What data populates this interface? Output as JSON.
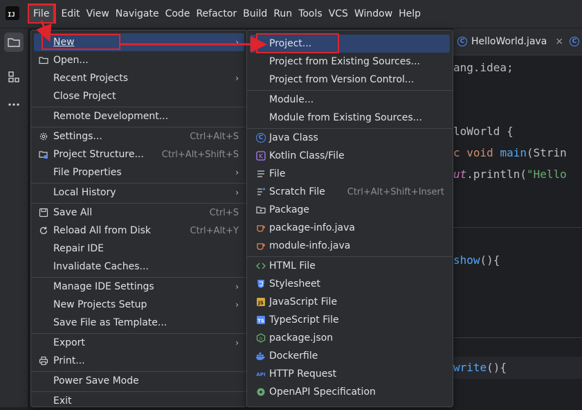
{
  "app": {
    "logo_text": "IJ"
  },
  "menubar": [
    "File",
    "Edit",
    "View",
    "Navigate",
    "Code",
    "Refactor",
    "Build",
    "Run",
    "Tools",
    "VCS",
    "Window",
    "Help"
  ],
  "tabs": [
    {
      "label": "HelloWorld.java",
      "close": "×"
    }
  ],
  "code": {
    "line1": "ang.idea;",
    "line2": "loWorld {",
    "line3a": "c void ",
    "line3b": "main",
    "line3c": "(Strin",
    "line4a": "ut",
    "line4b": ".println(",
    "line4c": "\"Hello",
    "line5a": "show",
    "line5b": "(){",
    "line6a": "write",
    "line6b": "(){"
  },
  "file_menu": {
    "items": [
      {
        "label": "New",
        "arrow": "›"
      },
      {
        "label": "Open..."
      },
      {
        "label": "Recent Projects",
        "arrow": "›"
      },
      {
        "label": "Close Project"
      },
      {
        "label": "Remote Development..."
      },
      {
        "label": "Settings...",
        "shortcut": "Ctrl+Alt+S"
      },
      {
        "label": "Project Structure...",
        "shortcut": "Ctrl+Alt+Shift+S"
      },
      {
        "label": "File Properties",
        "arrow": "›"
      },
      {
        "label": "Local History",
        "arrow": "›"
      },
      {
        "label": "Save All",
        "shortcut": "Ctrl+S"
      },
      {
        "label": "Reload All from Disk",
        "shortcut": "Ctrl+Alt+Y"
      },
      {
        "label": "Repair IDE"
      },
      {
        "label": "Invalidate Caches..."
      },
      {
        "label": "Manage IDE Settings",
        "arrow": "›"
      },
      {
        "label": "New Projects Setup",
        "arrow": "›"
      },
      {
        "label": "Save File as Template..."
      },
      {
        "label": "Export",
        "arrow": "›"
      },
      {
        "label": "Print..."
      },
      {
        "label": "Power Save Mode"
      },
      {
        "label": "Exit"
      }
    ]
  },
  "new_submenu": {
    "items": [
      {
        "label": "Project..."
      },
      {
        "label": "Project from Existing Sources..."
      },
      {
        "label": "Project from Version Control..."
      },
      {
        "label": "Module..."
      },
      {
        "label": "Module from Existing Sources..."
      },
      {
        "label": "Java Class"
      },
      {
        "label": "Kotlin Class/File"
      },
      {
        "label": "File"
      },
      {
        "label": "Scratch File",
        "shortcut": "Ctrl+Alt+Shift+Insert"
      },
      {
        "label": "Package"
      },
      {
        "label": "package-info.java"
      },
      {
        "label": "module-info.java"
      },
      {
        "label": "HTML File"
      },
      {
        "label": "Stylesheet"
      },
      {
        "label": "JavaScript File"
      },
      {
        "label": "TypeScript File"
      },
      {
        "label": "package.json"
      },
      {
        "label": "Dockerfile"
      },
      {
        "label": "HTTP Request"
      },
      {
        "label": "OpenAPI Specification"
      }
    ]
  },
  "colors": {
    "accent": "#2e436e",
    "annotation": "#e0242b",
    "background": "#2b2d30"
  }
}
